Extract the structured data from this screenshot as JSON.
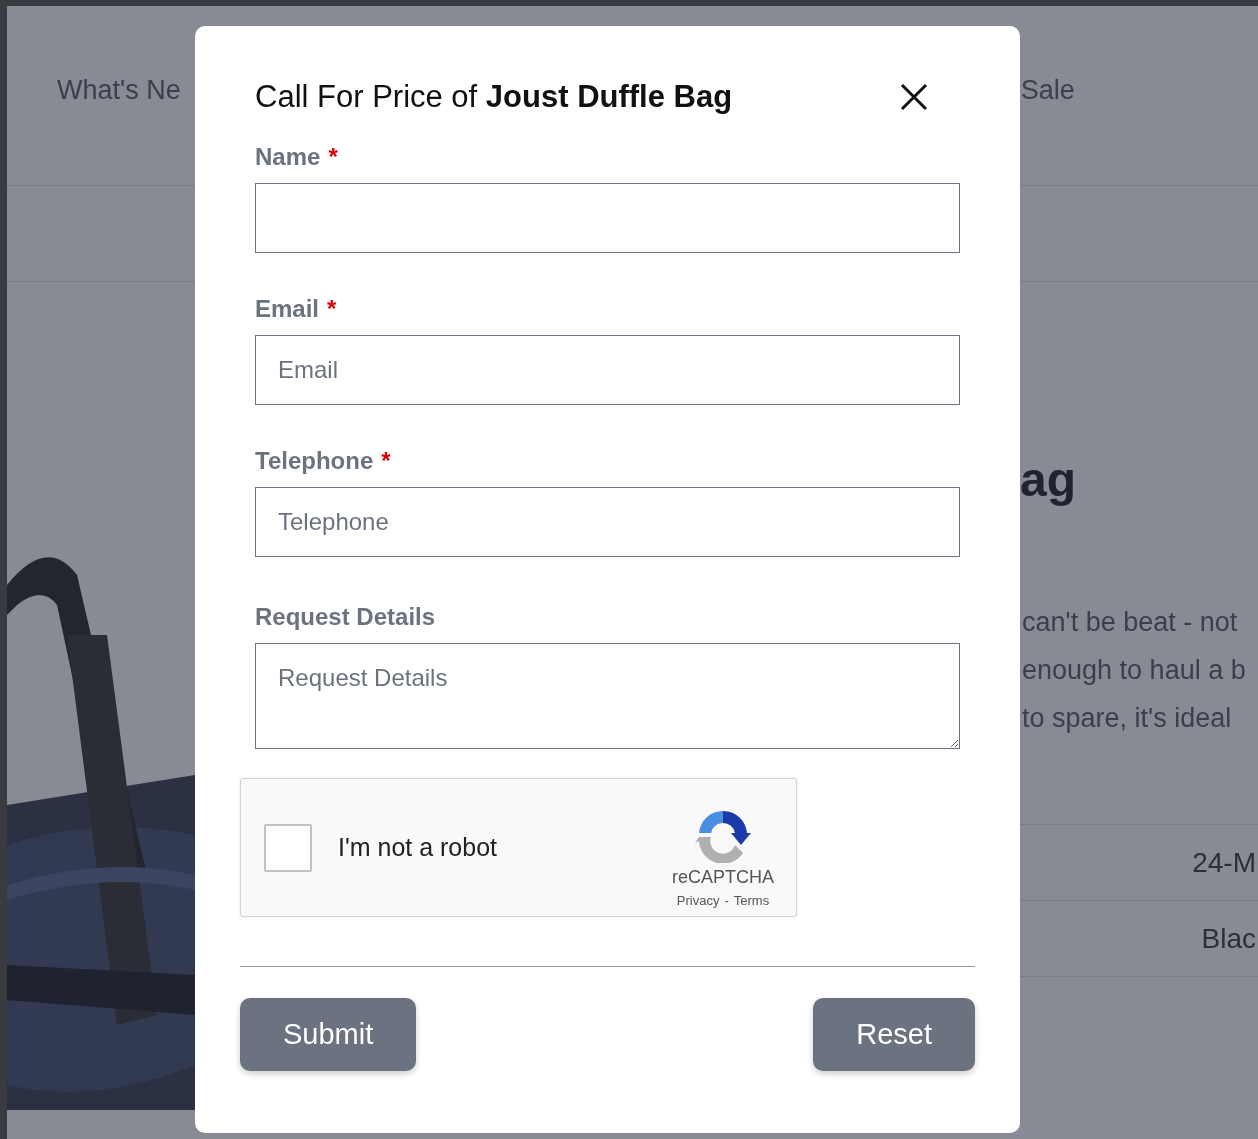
{
  "nav": [
    {
      "label": "What's Ne"
    },
    {
      "label": "Sale"
    }
  ],
  "product": {
    "title": "ag",
    "description_lines": [
      "can't be beat - not",
      "enough to haul a b",
      "to spare, it's ideal"
    ],
    "table_cells": [
      "24-M",
      "Blac"
    ],
    "image": {
      "kind": "picture"
    }
  },
  "modal": {
    "title": "Call For Price of **Joust Duffle Bag**",
    "required_mark": "*",
    "fields": [
      {
        "label": "Name",
        "required": true,
        "kind": "input"
      },
      {
        "label": "Email",
        "required": true,
        "kind": "input",
        "placeholder": "Email"
      },
      {
        "label": "Telephone",
        "required": true,
        "kind": "input",
        "placeholder": "Telephone"
      },
      {
        "label": "Request Details",
        "required": false,
        "kind": "textarea",
        "placeholder": "Request Details"
      }
    ],
    "captcha": {
      "checked": false,
      "label": "I'm not a robot",
      "brand": "reCAPTCHA",
      "links": [
        "Privacy",
        "Terms"
      ],
      "separator": "-"
    },
    "buttons": [
      "Submit",
      "Reset"
    ]
  }
}
